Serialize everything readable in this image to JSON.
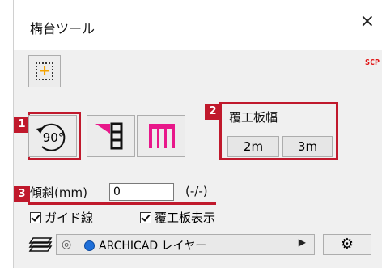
{
  "window": {
    "title": "構台ツール",
    "close_symbol": "×",
    "tag": "SCP"
  },
  "badges": [
    "1",
    "2",
    "3"
  ],
  "rotate": {
    "label": "90°"
  },
  "board_width": {
    "label": "覆工板幅",
    "options": [
      "2m",
      "3m"
    ]
  },
  "slope": {
    "label": "傾斜(mm)",
    "value": "0",
    "unit": "(-/-)"
  },
  "checks": [
    {
      "label": "ガイド線",
      "checked": true
    },
    {
      "label": "覆工板表示",
      "checked": true
    }
  ],
  "layer": {
    "name": "ARCHICAD レイヤー"
  },
  "colors": {
    "accent": "#e8188a",
    "annotation": "#c0192c",
    "add_icon": "#f5a300"
  }
}
